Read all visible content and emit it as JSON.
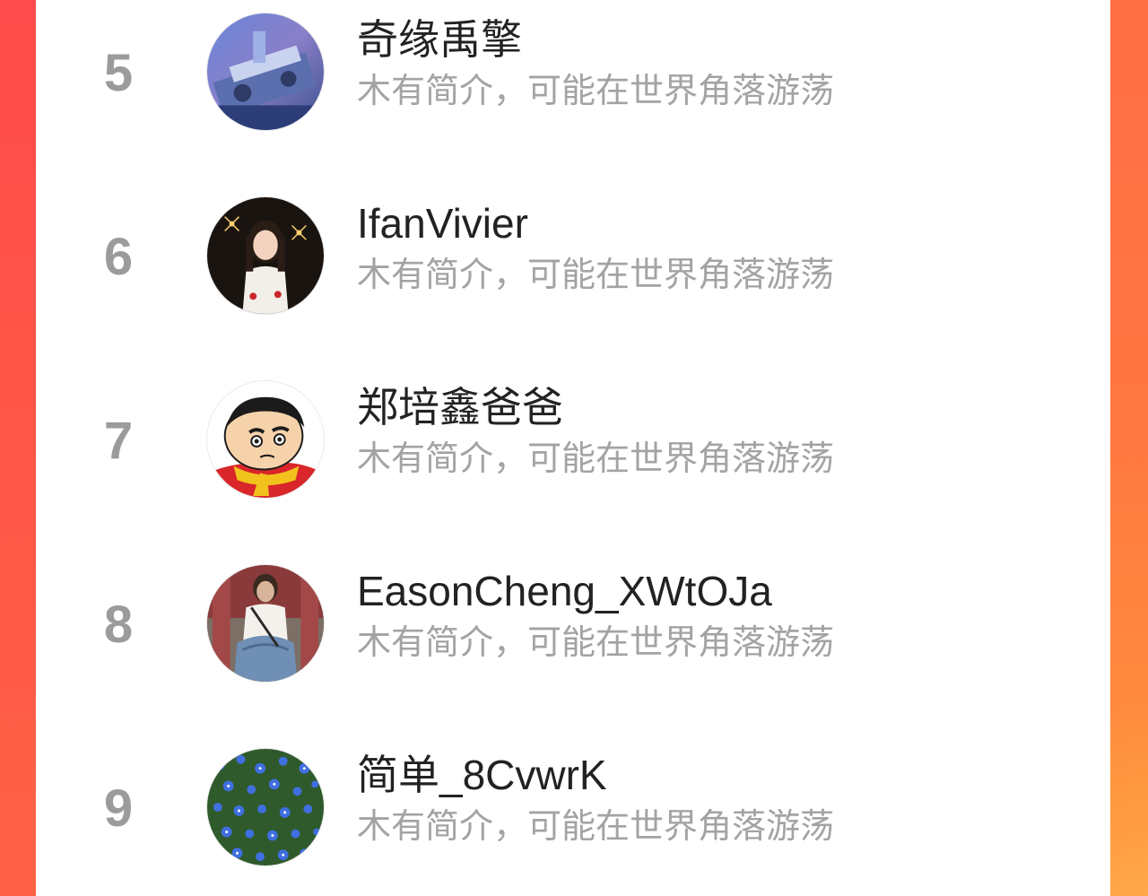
{
  "ranking": {
    "items": [
      {
        "rank": "5",
        "name": "奇缘禹擎",
        "bio": "木有简介，可能在世界角落游荡",
        "avatar": "mecha-avatar-icon"
      },
      {
        "rank": "6",
        "name": "IfanVivier",
        "bio": "木有简介，可能在世界角落游荡",
        "avatar": "girl-sparkler-avatar-icon"
      },
      {
        "rank": "7",
        "name": "郑培鑫爸爸",
        "bio": "木有简介，可能在世界角落游荡",
        "avatar": "cartoon-boy-avatar-icon"
      },
      {
        "rank": "8",
        "name": "EasonCheng_XWtOJa",
        "bio": "木有简介，可能在世界角落游荡",
        "avatar": "man-denim-avatar-icon"
      },
      {
        "rank": "9",
        "name": "简单_8CvwrK",
        "bio": "木有简介，可能在世界角落游荡",
        "avatar": "blue-flowers-avatar-icon"
      }
    ]
  },
  "colors": {
    "accent_left": "#ff4c4c",
    "accent_right": "#ff7a3f",
    "rank_text": "#9b9b9b",
    "name_text": "#222222",
    "bio_text": "#a3a3a3"
  }
}
